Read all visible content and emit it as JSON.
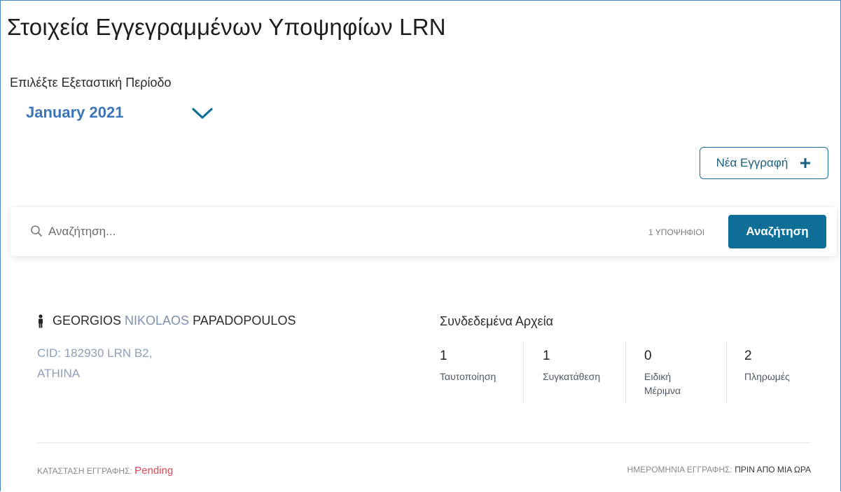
{
  "page": {
    "title": "Στοιχεία Εγγεγραμμένων Υποψηφίων LRN",
    "period_label": "Επιλέξτε Εξεταστική Περίοδο",
    "period_value": "January 2021"
  },
  "actions": {
    "new_registration_label": "Νέα Εγγραφή"
  },
  "search": {
    "placeholder": "Αναζήτηση...",
    "value": "",
    "count_text": "1 ΥΠΟΨΗΦΙΟΙ",
    "button_label": "Αναζήτηση"
  },
  "candidate": {
    "first_name": "GEORGIOS",
    "middle_name": "NIKOLAOS",
    "last_name": "PAPADOPOULOS",
    "cid_line": "CID: 182930 LRN B2,",
    "city": "ATHINA",
    "files_title": "Συνδεδεμένα Αρχεία",
    "files": [
      {
        "count": "1",
        "label": "Ταυτοποίηση"
      },
      {
        "count": "1",
        "label": "Συγκατάθεση"
      },
      {
        "count": "0",
        "label": "Ειδική Μέριμνα"
      },
      {
        "count": "2",
        "label": "Πληρωμές"
      }
    ],
    "status_label": "ΚΑΤΑΣΤΑΣΗ ΕΓΓΡΑΦΗΣ:",
    "status_value": "Pending",
    "date_label": "ΗΜΕΡΟΜΗΝΙΑ ΕΓΓΡΑΦΗΣ:",
    "date_value": "ΠΡΙΝ ΑΠΟ ΜΙΑ ΩΡΑ"
  },
  "colors": {
    "accent": "#0f6e98",
    "period_text": "#3b76b8",
    "status_pending": "#e0455a"
  },
  "icons": {
    "period_dropdown": "chevron-down-icon",
    "new_registration": "plus-icon",
    "search": "search-icon",
    "candidate": "person-icon"
  }
}
